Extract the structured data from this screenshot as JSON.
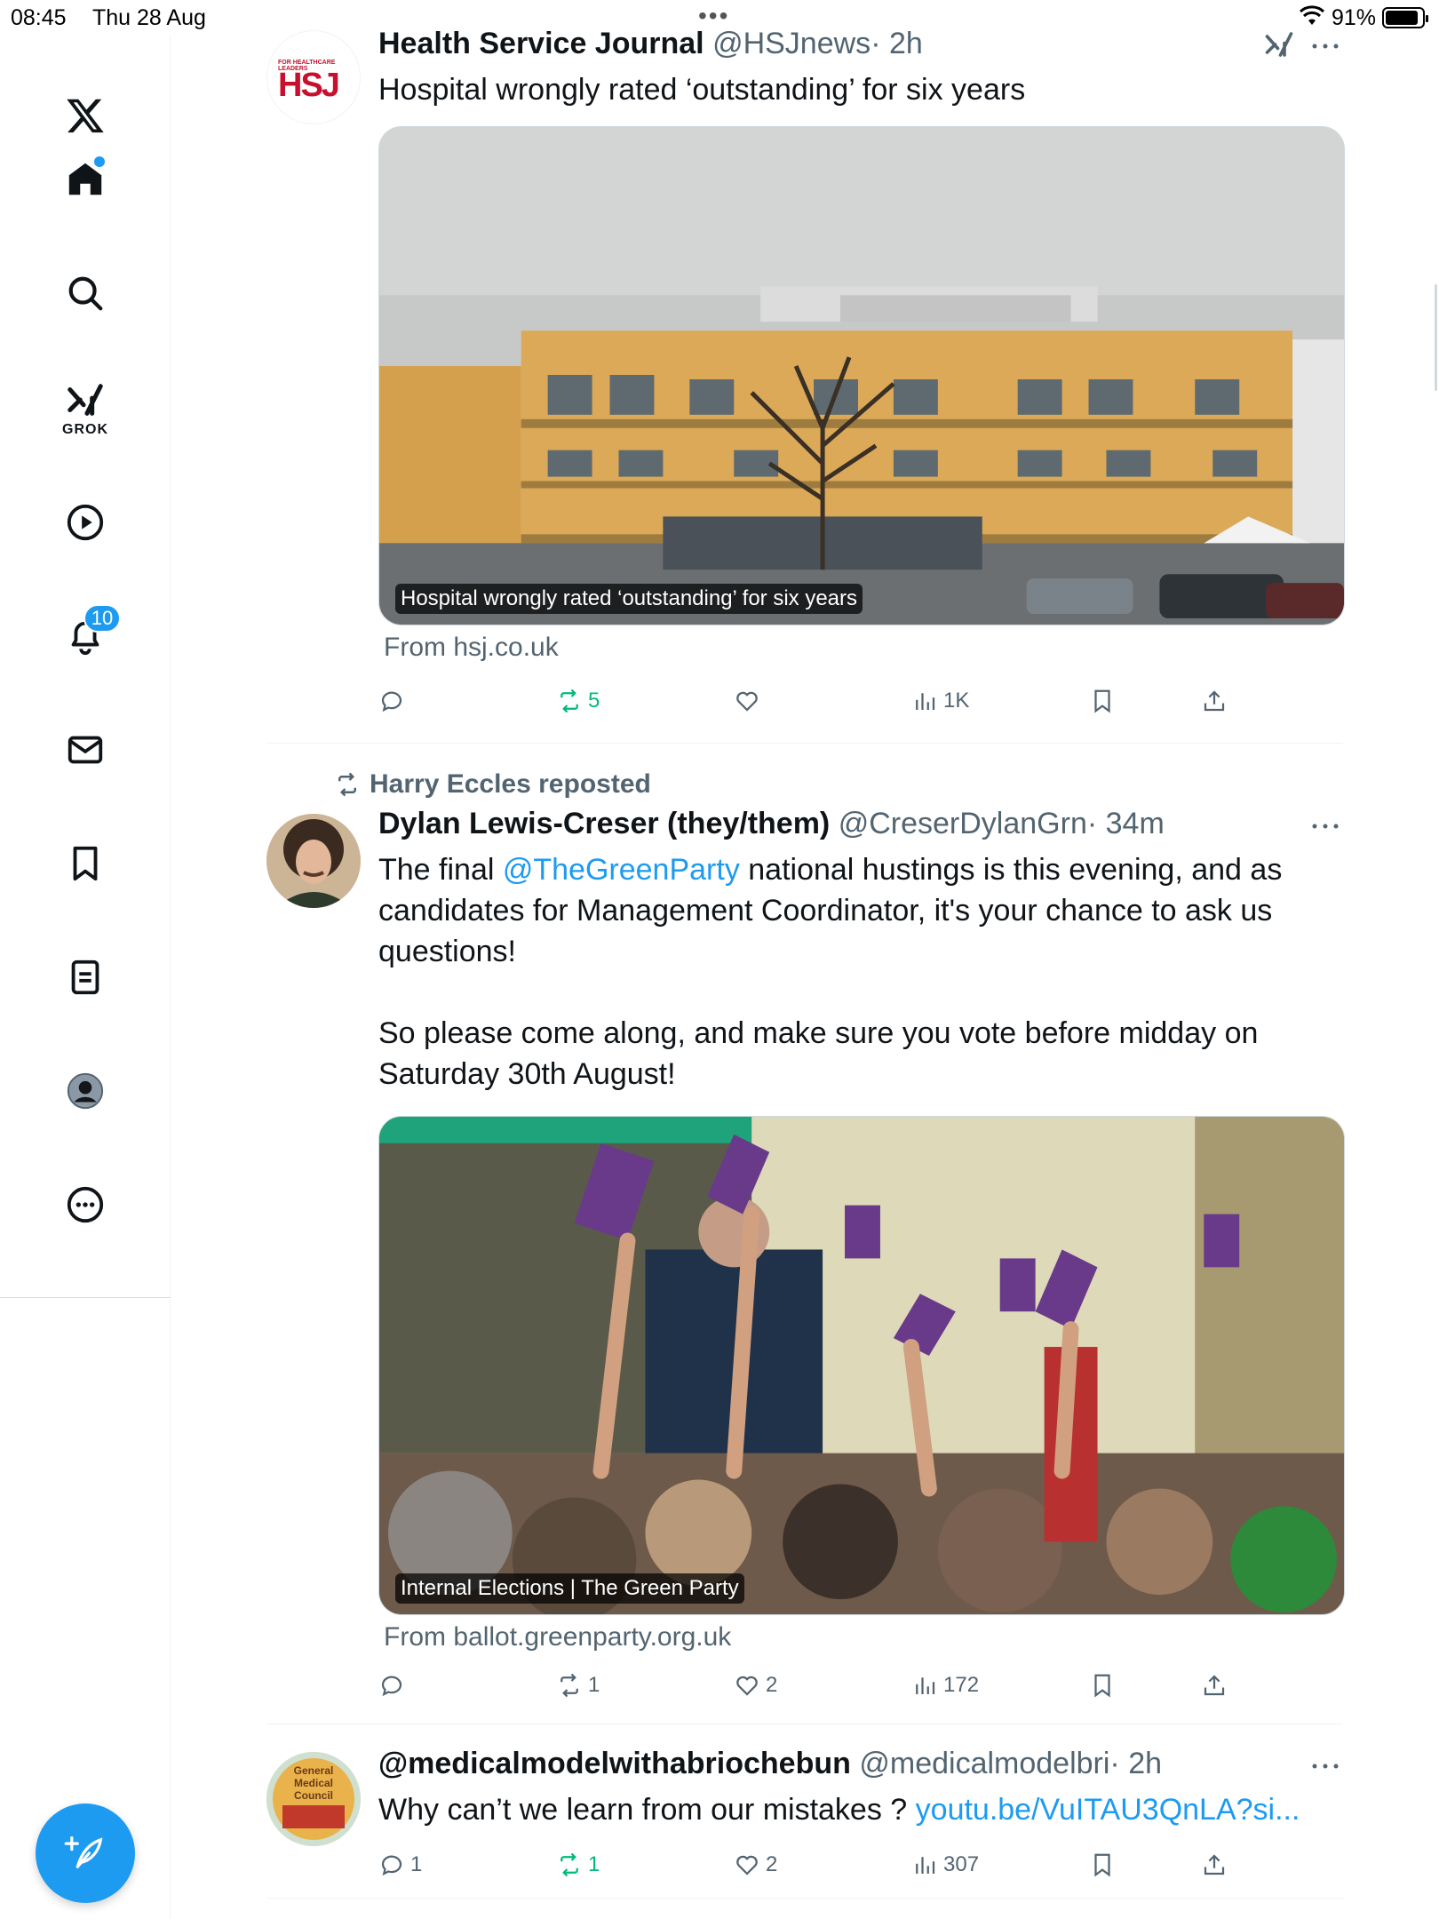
{
  "status_bar": {
    "time": "08:45",
    "date": "Thu 28 Aug",
    "battery": "91%"
  },
  "sidebar": {
    "items": [
      {
        "name": "home",
        "label": ""
      },
      {
        "name": "search",
        "label": ""
      },
      {
        "name": "grok",
        "label": "GROK"
      },
      {
        "name": "video",
        "label": ""
      },
      {
        "name": "notifications",
        "label": "",
        "badge": "10"
      },
      {
        "name": "messages",
        "label": ""
      },
      {
        "name": "bookmarks",
        "label": ""
      },
      {
        "name": "lists",
        "label": ""
      },
      {
        "name": "profile",
        "label": ""
      },
      {
        "name": "more",
        "label": ""
      }
    ]
  },
  "tweets": [
    {
      "author": "Health Service Journal",
      "handle": "@HSJnews",
      "time": "· 2h",
      "avatar_text": "HSJ",
      "avatar_subtext": "FOR HEALTHCARE LEADERS",
      "text": "Hospital wrongly rated ‘outstanding’ for six years",
      "card_caption": "Hospital wrongly rated ‘outstanding’ for six years",
      "card_source": "From hsj.co.uk",
      "actions": {
        "replies": "",
        "reposts": "5",
        "likes": "",
        "views": "1K"
      }
    },
    {
      "repost_context": "Harry Eccles reposted",
      "author": "Dylan Lewis-Creser (they/them)",
      "handle": "@CreserDylanGrn",
      "time": "· 34m",
      "text_prefix": "The final ",
      "mention": "@TheGreenParty",
      "text_line1_suffix": " national hustings is this evening, and as",
      "text_line2": "candidates for Management Coordinator, it's your chance to ask us",
      "text_line3": "questions!",
      "text_line4": "So please come along, and make sure you vote before midday on",
      "text_line5": "Saturday 30th August!",
      "card_caption": "Internal Elections | The Green Party",
      "card_source": "From ballot.greenparty.org.uk",
      "actions": {
        "replies": "",
        "reposts": "1",
        "likes": "2",
        "views": "172"
      }
    },
    {
      "author": "@medicalmodelwithabriochebun",
      "handle": "@medicalmodelbri",
      "time": "· 2h",
      "avatar_text": "General Medical Council",
      "text": "Why can’t we learn from our mistakes ? ",
      "link": "youtu.be/VuITAU3QnLA?si...",
      "actions": {
        "replies": "1",
        "reposts": "1",
        "likes": "2",
        "views": "307"
      }
    }
  ],
  "colors": {
    "accent": "#1d9bf0",
    "repost_green": "#00ba7c",
    "muted": "#536471"
  }
}
